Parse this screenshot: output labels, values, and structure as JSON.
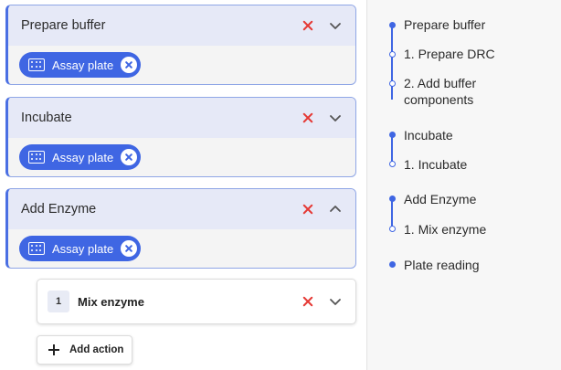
{
  "sections": [
    {
      "title": "Prepare buffer",
      "chip_label": "Assay plate",
      "expanded": false
    },
    {
      "title": "Incubate",
      "chip_label": "Assay plate",
      "expanded": false
    },
    {
      "title": "Add Enzyme",
      "chip_label": "Assay plate",
      "expanded": true
    }
  ],
  "action": {
    "number": "1",
    "title": "Mix enzyme"
  },
  "add_action_label": "Add action",
  "outline": {
    "prepare_buffer": "Prepare buffer",
    "prepare_drc": "1. Prepare DRC",
    "add_buffer_line1": "2. Add buffer",
    "add_buffer_line2": "components",
    "incubate": "Incubate",
    "incubate_step": "1. Incubate",
    "add_enzyme": "Add Enzyme",
    "mix_enzyme": "1. Mix enzyme",
    "plate_reading": "Plate reading"
  },
  "colors": {
    "accent": "#3f66e3",
    "delete": "#e53935",
    "header_bg": "#e6e9f7"
  }
}
